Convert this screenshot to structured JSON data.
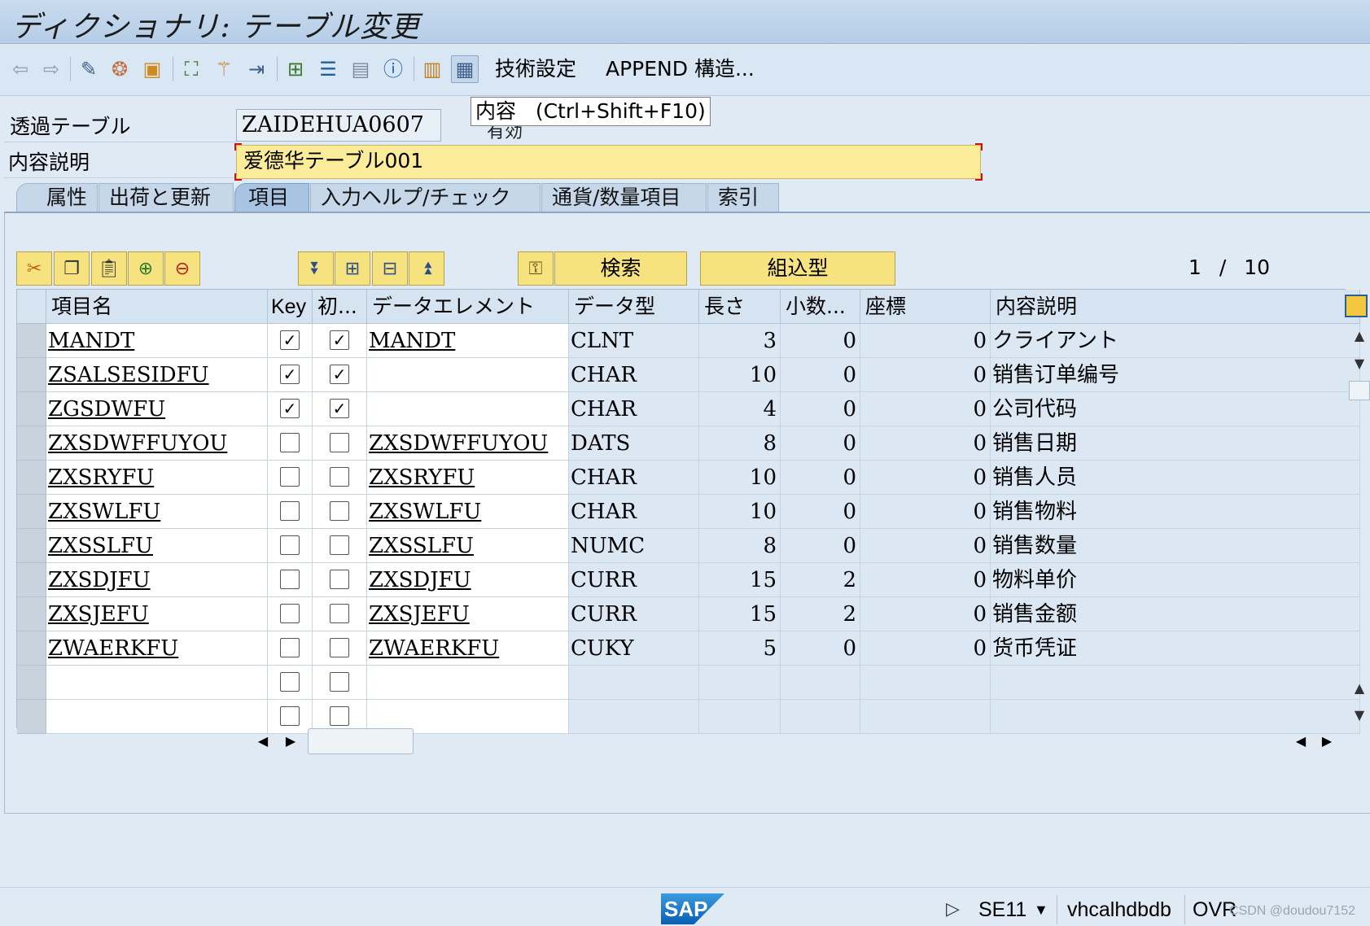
{
  "window": {
    "title": "ディクショナリ: テーブル変更"
  },
  "toolbar": {
    "icons": [
      "back-icon",
      "forward-icon",
      "display-change-icon",
      "other-object-icon",
      "check-icon",
      "activate-icon",
      "where-used-icon",
      "object-list-icon",
      "display-object-list-icon",
      "navigate-icon",
      "hierarchy-icon",
      "info-icon",
      "layout-icon",
      "contents-icon"
    ],
    "tech_settings_label": "技術設定",
    "append_label": "APPEND 構造..."
  },
  "tooltip": {
    "text": "内容   (Ctrl+Shift+F10)",
    "peek_text": "有効"
  },
  "header": {
    "table_type_label": "透過テーブル",
    "table_name": "ZAIDEHUA0607",
    "description_label": "内容説明",
    "description_value": "爱德华テーブル001"
  },
  "tabs": [
    {
      "label": "属性"
    },
    {
      "label": "出荷と更新"
    },
    {
      "label": "項目",
      "active": true
    },
    {
      "label": "入力ヘルプ/チェック"
    },
    {
      "label": "通貨/数量項目"
    },
    {
      "label": "索引"
    }
  ],
  "table_toolbar": {
    "search_label": "検索",
    "builtin_type_label": "組込型",
    "page_current": "1",
    "page_sep": "/",
    "page_total": "10"
  },
  "grid": {
    "columns": [
      "項目名",
      "Key",
      "初...",
      "データエレメント",
      "データ型",
      "長さ",
      "小数...",
      "座標",
      "内容説明"
    ],
    "rows": [
      {
        "field": "MANDT",
        "key": true,
        "initial": true,
        "element": "MANDT",
        "type": "CLNT",
        "length": "3",
        "decimals": "0",
        "coord": "0",
        "desc": "クライアント"
      },
      {
        "field": "ZSALSESIDFU",
        "key": true,
        "initial": true,
        "element": "",
        "type": "CHAR",
        "length": "10",
        "decimals": "0",
        "coord": "0",
        "desc": "销售订单编号"
      },
      {
        "field": "ZGSDWFU",
        "key": true,
        "initial": true,
        "element": "",
        "type": "CHAR",
        "length": "4",
        "decimals": "0",
        "coord": "0",
        "desc": "公司代码"
      },
      {
        "field": "ZXSDWFFUYOU",
        "key": false,
        "initial": false,
        "element": "ZXSDWFFUYOU",
        "type": "DATS",
        "length": "8",
        "decimals": "0",
        "coord": "0",
        "desc": "销售日期"
      },
      {
        "field": "ZXSRYFU",
        "key": false,
        "initial": false,
        "element": "ZXSRYFU",
        "type": "CHAR",
        "length": "10",
        "decimals": "0",
        "coord": "0",
        "desc": "销售人员"
      },
      {
        "field": "ZXSWLFU",
        "key": false,
        "initial": false,
        "element": "ZXSWLFU",
        "type": "CHAR",
        "length": "10",
        "decimals": "0",
        "coord": "0",
        "desc": "销售物料"
      },
      {
        "field": "ZXSSLFU",
        "key": false,
        "initial": false,
        "element": "ZXSSLFU",
        "type": "NUMC",
        "length": "8",
        "decimals": "0",
        "coord": "0",
        "desc": "销售数量"
      },
      {
        "field": "ZXSDJFU",
        "key": false,
        "initial": false,
        "element": "ZXSDJFU",
        "type": "CURR",
        "length": "15",
        "decimals": "2",
        "coord": "0",
        "desc": "物料单价"
      },
      {
        "field": "ZXSJEFU",
        "key": false,
        "initial": false,
        "element": "ZXSJEFU",
        "type": "CURR",
        "length": "15",
        "decimals": "2",
        "coord": "0",
        "desc": "销售金额"
      },
      {
        "field": "ZWAERKFU",
        "key": false,
        "initial": false,
        "element": "ZWAERKFU",
        "type": "CUKY",
        "length": "5",
        "decimals": "0",
        "coord": "0",
        "desc": "货币凭证"
      },
      {
        "field": "",
        "key": false,
        "initial": false,
        "element": "",
        "type": "",
        "length": "",
        "decimals": "",
        "coord": "",
        "desc": ""
      },
      {
        "field": "",
        "key": false,
        "initial": false,
        "element": "",
        "type": "",
        "length": "",
        "decimals": "",
        "coord": "",
        "desc": ""
      }
    ]
  },
  "statusbar": {
    "logo": "SAP",
    "transaction": "SE11",
    "host": "vhcalhdbdb",
    "mode": "OVR",
    "watermark": "CSDN @doudou7152"
  }
}
